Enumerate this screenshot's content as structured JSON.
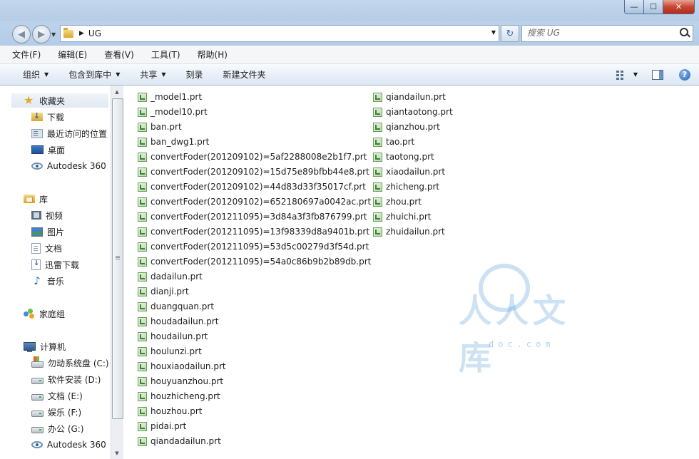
{
  "window": {
    "min_label": "—",
    "max_label": "☐",
    "close_label": "✕"
  },
  "nav": {
    "back_label": "◀",
    "forward_label": "▶",
    "dropdown_label": "▼"
  },
  "address": {
    "sep_label": "▶",
    "path": "UG",
    "dropdown_label": "▼",
    "refresh_label": "↻"
  },
  "search": {
    "placeholder": "搜索 UG"
  },
  "menubar": {
    "items": [
      "文件(F)",
      "编辑(E)",
      "查看(V)",
      "工具(T)",
      "帮助(H)"
    ]
  },
  "toolbar": {
    "organize": "组织",
    "include_in_library": "包含到库中",
    "share": "共享",
    "burn": "刻录",
    "new_folder": "新建文件夹",
    "arrow": "▼",
    "help_label": "?"
  },
  "sidebar": {
    "favorites": "收藏夹",
    "downloads": "下载",
    "recent": "最近访问的位置",
    "desktop": "桌面",
    "autodesk1": "Autodesk 360",
    "libraries": "库",
    "videos": "视频",
    "pictures": "图片",
    "documents": "文档",
    "thunder": "迅雷下载",
    "music": "音乐",
    "homegroup": "家庭组",
    "computer": "计算机",
    "drive_c": "勿动系统盘 (C:)",
    "drive_d": "软件安装 (D:)",
    "drive_e": "文档 (E:)",
    "drive_f": "娱乐 (F:)",
    "drive_g": "办公 (G:)",
    "autodesk2": "Autodesk 360"
  },
  "scroll": {
    "up": "▲",
    "down": "▼"
  },
  "files": {
    "col1": [
      "_model1.prt",
      "_model10.prt",
      "ban.prt",
      "ban_dwg1.prt",
      "convertFoder(201209102)=5af2288008e2b1f7.prt",
      "convertFoder(201209102)=15d75e89bfbb44e8.prt",
      "convertFoder(201209102)=44d83d33f35017cf.prt",
      "convertFoder(201209102)=652180697a0042ac.prt",
      "convertFoder(201211095)=3d84a3f3fb876799.prt",
      "convertFoder(201211095)=13f98339d8a9401b.prt",
      "convertFoder(201211095)=53d5c00279d3f54d.prt",
      "convertFoder(201211095)=54a0c86b9b2b89db.prt",
      "dadailun.prt",
      "dianji.prt",
      "duangquan.prt",
      "houdadailun.prt",
      "houdailun.prt",
      "houlunzi.prt",
      "houxiaodailun.prt",
      "houyuanzhou.prt",
      "houzhicheng.prt",
      "houzhou.prt",
      "pidai.prt",
      "qiandadailun.prt"
    ],
    "col2": [
      "qiandailun.prt",
      "qiantaotong.prt",
      "qianzhou.prt",
      "tao.prt",
      "taotong.prt",
      "xiaodailun.prt",
      "zhicheng.prt",
      "zhou.prt",
      "zhuichi.prt",
      "zhuidailun.prt"
    ]
  },
  "watermark": {
    "text": "人人文库",
    "sub": "doc.com"
  }
}
